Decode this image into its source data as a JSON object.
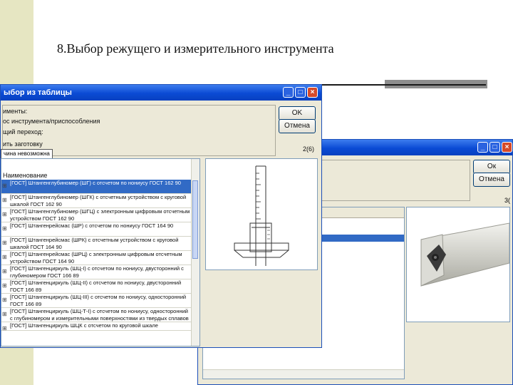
{
  "slide": {
    "title": "8.Выбор режущего и измерительного инструмента"
  },
  "window_front": {
    "title": "ыбор из таблицы",
    "ok_label": "OK",
    "cancel_label": "Отмена",
    "info_lines": [
      "именты:",
      "ос инструмента/приспособления",
      "щий переход:",
      "ить заготовку"
    ],
    "badge": "чина невозможна",
    "counter": "2(6)",
    "list_header": "Наименование",
    "rows": [
      "[ГОСТ] Штангенглубиномер (ШГ) с отсчетом по нониусу ГОСТ 162 90",
      "[ГОСТ] Штангенглубиномер (ШГК) с отсчетным устройством с круговой шкалой ГОСТ 162 90",
      "[ГОСТ] Штангенглубиномер (ШГЦ) с электронным цифровым отсчетным устройством ГОСТ 162 90",
      "[ГОСТ] Штангенрейсмас (ШР) с отсчетом по нониусу ГОСТ 164 90",
      "[ГОСТ] Штангенрейсмас (ШРК) с отсчетным устройством с круговой шкалой ГОСТ 164 90",
      "[ГОСТ] Штангенрейсмас (ШРЦ) с электронным цифровым отсчетным устройством ГОСТ 164 90",
      "[ГОСТ] Штангенциркуль (ШЦ-I) с отсчетом по нониусу, двусторонний с глубиномером ГОСТ 166 89",
      "[ГОСТ] Штангенциркуль (ШЦ-II) с отсчетом по нониусу, двусторонний ГОСТ 166 89",
      "[ГОСТ] Штангенциркуль (ШЦ-III) с отсчетом по нониусу, односторонний ГОСТ 166 89",
      "[ГОСТ] Штангенциркуль (ШЦ-Т-I) с отсчетом по нониусу, односторонний с глубиномером и измерительными поверхностями из твердых сплавов ГОСТ 166 89",
      "[ГОСТ] Штангенциркуль ШЦК с отсчетом по круговой шкале"
    ]
  },
  "window_back": {
    "ok_label": "Ок",
    "cancel_label": "Отмена",
    "counter": "3("
  },
  "colors": {
    "strip": "#e6e6c2",
    "selection": "#316ac5",
    "titlebar": "#0a4ad4"
  }
}
